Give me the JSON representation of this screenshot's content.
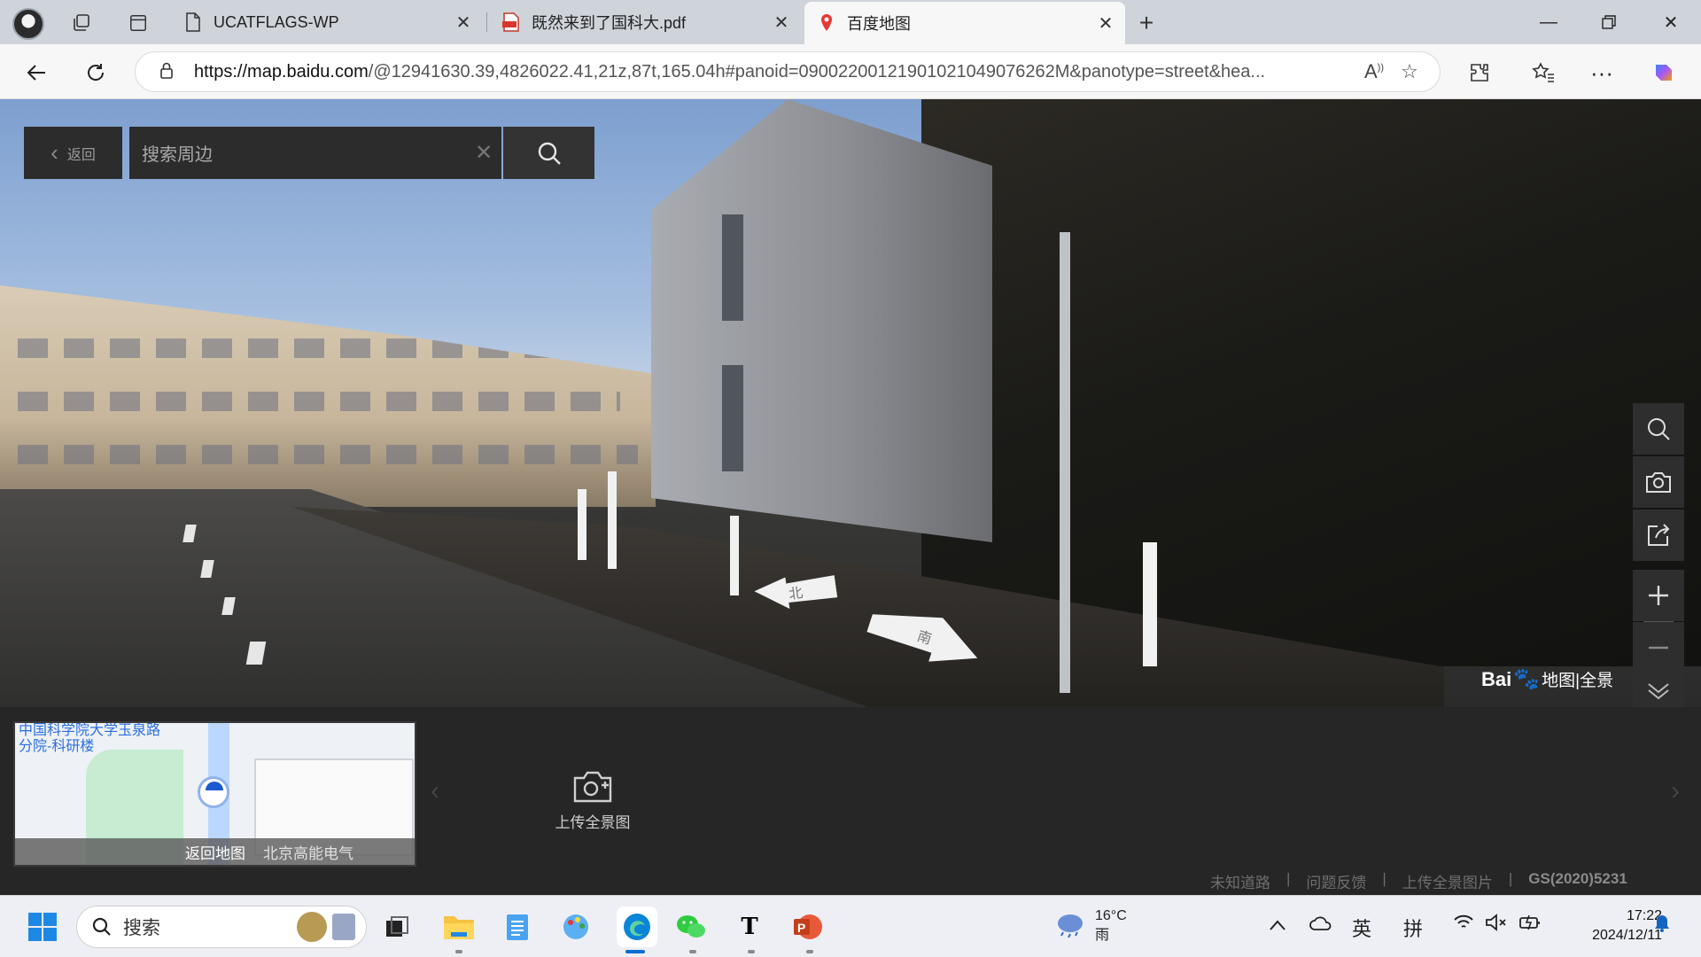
{
  "browser": {
    "tabs": [
      {
        "title": "UCATFLAGS-WP",
        "icon": "page-icon"
      },
      {
        "title": "既然来到了国科大.pdf",
        "icon": "pdf-icon"
      },
      {
        "title": "百度地图",
        "icon": "map-pin-icon",
        "active": true
      }
    ],
    "url_host": "https://map.baidu.com",
    "url_path": "/@12941630.39,4826022.41,21z,87t,165.04h#panoid=09002200121901021049076262M&panotype=street&hea..."
  },
  "panorama": {
    "back_label": "返回",
    "search_placeholder": "搜索周边",
    "arrow_left_label": "北",
    "arrow_right_label": "南",
    "logo_brand": "Bai",
    "logo_text": "地图|全景"
  },
  "minimap": {
    "place_label": "中国科学院大学玉泉路分院-科研楼",
    "back_to_map": "返回地图",
    "poi_label": "北京高能电气"
  },
  "bottom": {
    "upload_label": "上传全景图",
    "footer_links": [
      "未知道路",
      "问题反馈",
      "上传全景图片"
    ],
    "license": "GS(2020)5231"
  },
  "taskbar": {
    "search_label": "搜索",
    "weather_temp": "16°C",
    "weather_desc": "雨",
    "ime_lang": "英",
    "ime_mode": "拼",
    "time": "17:22",
    "date": "2024/12/11"
  },
  "colors": {
    "accent_blue": "#2c6fe0",
    "panel_dark": "#2c2c2c",
    "taskbar_bg": "#eeeff4"
  }
}
